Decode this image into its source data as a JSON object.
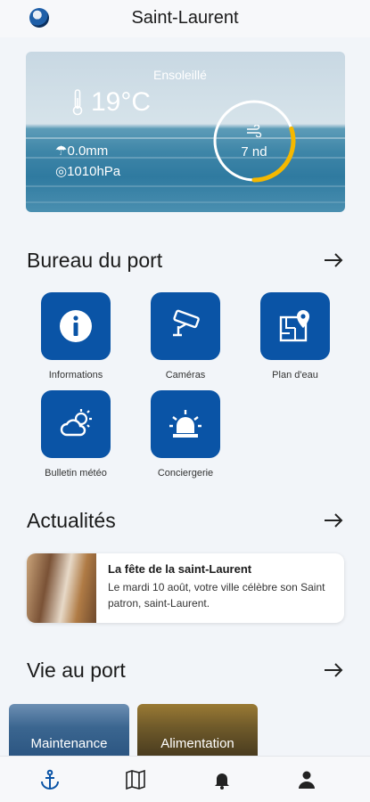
{
  "header": {
    "title": "Saint-Laurent",
    "logo_icon": "globe-logo-icon"
  },
  "weather": {
    "condition": "Ensoleillé",
    "temperature": "19°C",
    "rain": "0.0mm",
    "pressure": "1010hPa",
    "wind": "7 nd",
    "wind_gauge_fraction": 0.3,
    "gauge_color": "#f5b800"
  },
  "harbour": {
    "title": "Bureau du port",
    "tiles": [
      {
        "label": "Informations",
        "icon": "info-icon"
      },
      {
        "label": "Caméras",
        "icon": "camera-icon"
      },
      {
        "label": "Plan d'eau",
        "icon": "map-pin-icon"
      },
      {
        "label": "Bulletin météo",
        "icon": "weather-icon"
      },
      {
        "label": "Conciergerie",
        "icon": "alarm-light-icon"
      }
    ]
  },
  "news": {
    "title": "Actualités",
    "items": [
      {
        "title": "La fête de la saint-Laurent",
        "text": "Le mardi 10 août, votre ville célèbre son Saint patron, saint-Laurent."
      }
    ]
  },
  "life": {
    "title": "Vie au port",
    "cards": [
      {
        "label": "Maintenance"
      },
      {
        "label": "Alimentation"
      }
    ]
  },
  "nav": {
    "items": [
      "anchor-icon",
      "map-icon",
      "bell-icon",
      "user-icon"
    ]
  },
  "colors": {
    "accent": "#0a54a6",
    "background": "#f2f5f9"
  }
}
